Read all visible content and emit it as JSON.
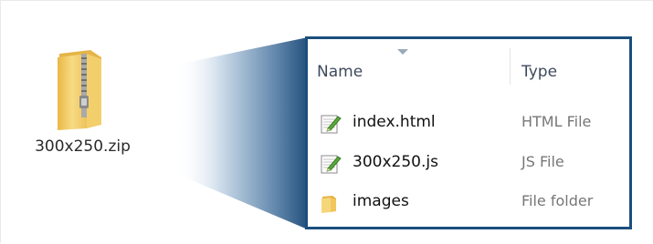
{
  "archive": {
    "filename": "300x250.zip",
    "icon": "zip-folder-icon"
  },
  "explorer": {
    "columns": {
      "name": "Name",
      "type": "Type"
    },
    "sort_indicator": "sort-ascending-icon",
    "files": [
      {
        "name": "index.html",
        "type": "HTML File",
        "icon": "html-file-icon"
      },
      {
        "name": "300x250.js",
        "type": "JS File",
        "icon": "js-file-icon"
      },
      {
        "name": "images",
        "type": "File folder",
        "icon": "folder-icon"
      }
    ]
  },
  "colors": {
    "panel_border": "#1b4e7d",
    "funnel_dark": "#23507d",
    "funnel_light": "#dde8f2",
    "folder": "#f6d67a"
  }
}
